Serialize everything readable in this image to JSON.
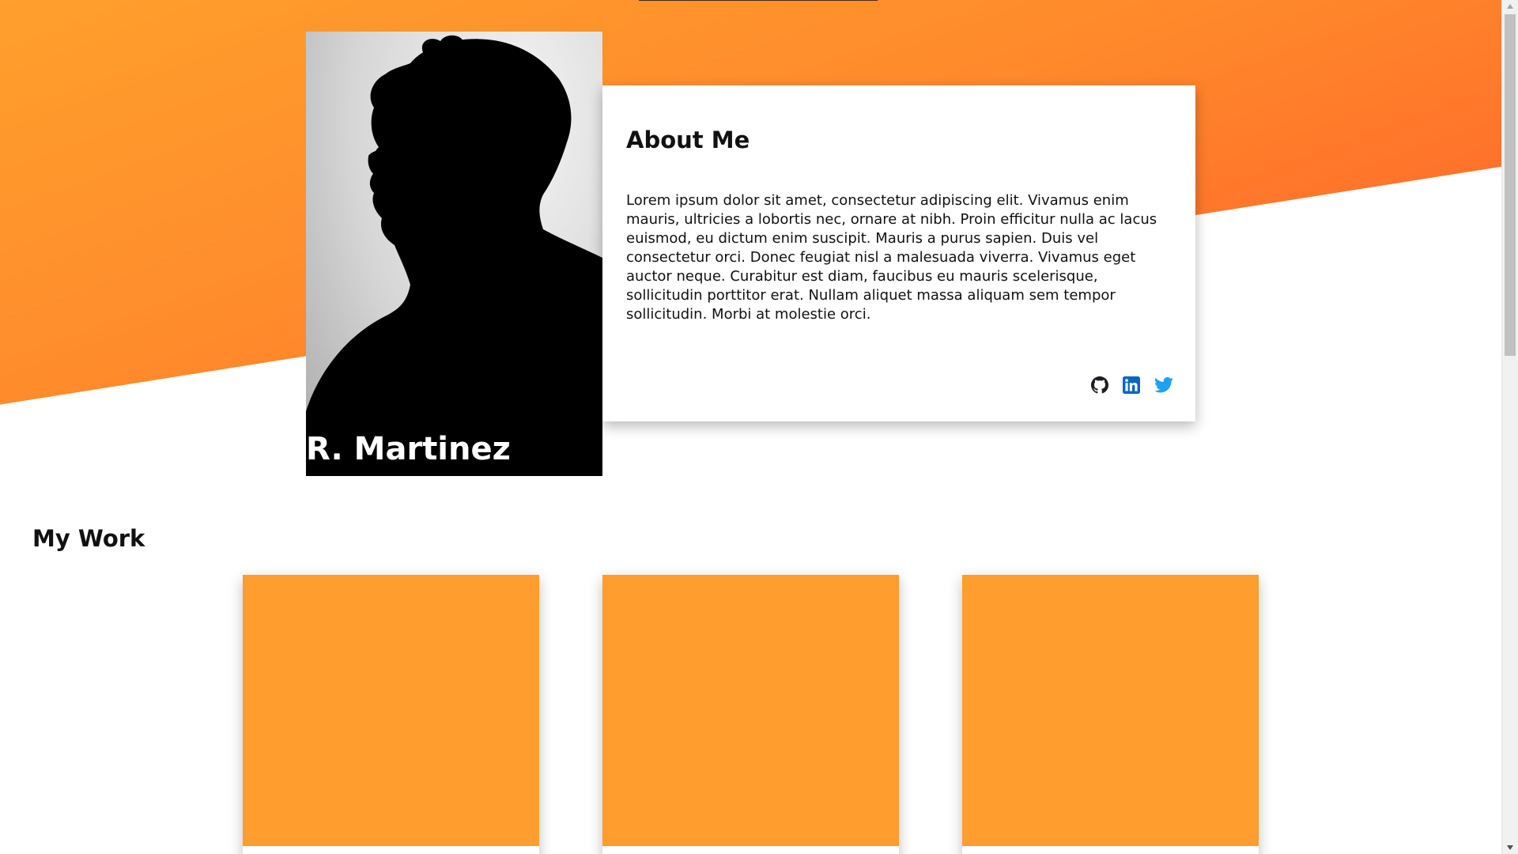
{
  "profile": {
    "name": "R. Martinez"
  },
  "about": {
    "title": "About Me",
    "text": "Lorem ipsum dolor sit amet, consectetur adipiscing elit. Vivamus enim mauris, ultricies a lobortis nec, ornare at nibh. Proin efficitur nulla ac lacus euismod, eu dictum enim suscipit. Mauris a purus sapien. Duis vel consectetur orci. Donec feugiat nisl a malesuada viverra. Vivamus eget auctor neque. Curabitur est diam, faucibus eu mauris scelerisque, sollicitudin porttitor erat. Nullam aliquet massa aliquam sem tempor sollicitudin. Morbi at molestie orci.",
    "social": [
      {
        "icon": "github-icon",
        "color": "#1b1f23"
      },
      {
        "icon": "linkedin-icon",
        "color": "#0a66c2"
      },
      {
        "icon": "twitter-icon",
        "color": "#1da1f2"
      }
    ]
  },
  "work": {
    "title": "My Work",
    "thumb_color": "#ff9d2f",
    "cards": [
      {
        "id": "work-1"
      },
      {
        "id": "work-2"
      },
      {
        "id": "work-3"
      }
    ]
  },
  "colors": {
    "hero_start": "#ff9f2d",
    "hero_end": "#ff5e2a"
  }
}
